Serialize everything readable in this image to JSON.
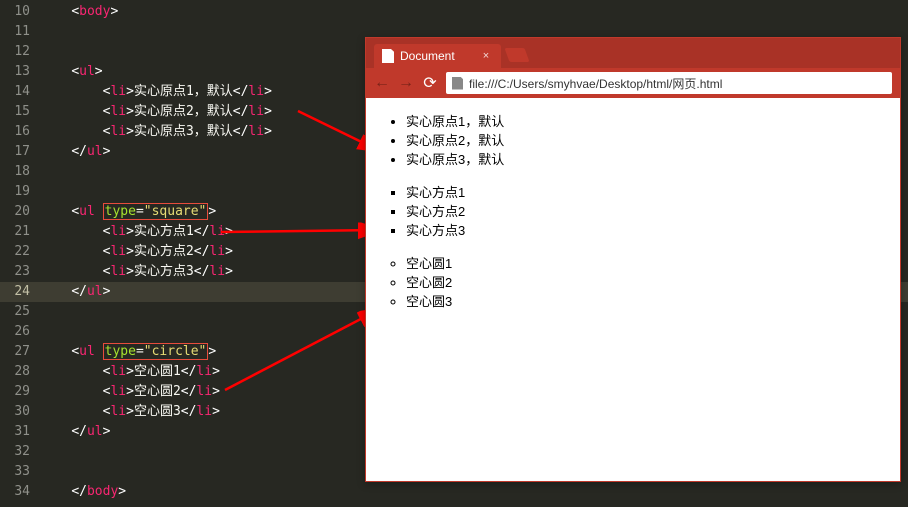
{
  "editor": {
    "lines": [
      {
        "n": 10,
        "html": "    <span class='br'>&lt;</span><span class='tag'>body</span><span class='br'>&gt;</span>"
      },
      {
        "n": 11,
        "html": ""
      },
      {
        "n": 12,
        "html": ""
      },
      {
        "n": 13,
        "html": "    <span class='br'>&lt;</span><span class='tag'>ul</span><span class='br'>&gt;</span>"
      },
      {
        "n": 14,
        "html": "        <span class='br'>&lt;</span><span class='tag'>li</span><span class='br'>&gt;</span>实心原点1，默认<span class='br'>&lt;/</span><span class='tag'>li</span><span class='br'>&gt;</span>"
      },
      {
        "n": 15,
        "html": "        <span class='br'>&lt;</span><span class='tag'>li</span><span class='br'>&gt;</span>实心原点2，默认<span class='br'>&lt;/</span><span class='tag'>li</span><span class='br'>&gt;</span>"
      },
      {
        "n": 16,
        "html": "        <span class='br'>&lt;</span><span class='tag'>li</span><span class='br'>&gt;</span>实心原点3，默认<span class='br'>&lt;/</span><span class='tag'>li</span><span class='br'>&gt;</span>"
      },
      {
        "n": 17,
        "html": "    <span class='br'>&lt;/</span><span class='tag'>ul</span><span class='br'>&gt;</span>"
      },
      {
        "n": 18,
        "html": ""
      },
      {
        "n": 19,
        "html": ""
      },
      {
        "n": 20,
        "html": "    <span class='br'>&lt;</span><span class='tag'>ul</span> <span class='boxed'><span class='attr'>type</span>=<span class='str'>&quot;square&quot;</span></span><span class='br'>&gt;</span>"
      },
      {
        "n": 21,
        "html": "        <span class='br'>&lt;</span><span class='tag'>li</span><span class='br'>&gt;</span>实心方点1<span class='br'>&lt;/</span><span class='tag'>li</span><span class='br'>&gt;</span>"
      },
      {
        "n": 22,
        "html": "        <span class='br'>&lt;</span><span class='tag'>li</span><span class='br'>&gt;</span>实心方点2<span class='br'>&lt;/</span><span class='tag'>li</span><span class='br'>&gt;</span>"
      },
      {
        "n": 23,
        "html": "        <span class='br'>&lt;</span><span class='tag'>li</span><span class='br'>&gt;</span>实心方点3<span class='br'>&lt;/</span><span class='tag'>li</span><span class='br'>&gt;</span>"
      },
      {
        "n": 24,
        "html": "    <span class='br'>&lt;/</span><span class='tag'>ul</span><span class='br'>&gt;</span>",
        "active": true
      },
      {
        "n": 25,
        "html": ""
      },
      {
        "n": 26,
        "html": ""
      },
      {
        "n": 27,
        "html": "    <span class='br'>&lt;</span><span class='tag'>ul</span> <span class='boxed'><span class='attr'>type</span>=<span class='str'>&quot;circle&quot;</span></span><span class='br'>&gt;</span>"
      },
      {
        "n": 28,
        "html": "        <span class='br'>&lt;</span><span class='tag'>li</span><span class='br'>&gt;</span>空心圆1<span class='br'>&lt;/</span><span class='tag'>li</span><span class='br'>&gt;</span>"
      },
      {
        "n": 29,
        "html": "        <span class='br'>&lt;</span><span class='tag'>li</span><span class='br'>&gt;</span>空心圆2<span class='br'>&lt;/</span><span class='tag'>li</span><span class='br'>&gt;</span>"
      },
      {
        "n": 30,
        "html": "        <span class='br'>&lt;</span><span class='tag'>li</span><span class='br'>&gt;</span>空心圆3<span class='br'>&lt;/</span><span class='tag'>li</span><span class='br'>&gt;</span>"
      },
      {
        "n": 31,
        "html": "    <span class='br'>&lt;/</span><span class='tag'>ul</span><span class='br'>&gt;</span>"
      },
      {
        "n": 32,
        "html": ""
      },
      {
        "n": 33,
        "html": ""
      },
      {
        "n": 34,
        "html": "    <span class='br'>&lt;/</span><span class='tag'>body</span><span class='br'>&gt;</span>"
      }
    ]
  },
  "browser": {
    "tab_title": "Document",
    "tab_close": "×",
    "url": "file:///C:/Users/smyhvae/Desktop/html/网页.html",
    "lists": [
      {
        "type": "disc",
        "items": [
          "实心原点1，默认",
          "实心原点2，默认",
          "实心原点3，默认"
        ]
      },
      {
        "type": "square",
        "items": [
          "实心方点1",
          "实心方点2",
          "实心方点3"
        ]
      },
      {
        "type": "circle",
        "items": [
          "空心圆1",
          "空心圆2",
          "空心圆3"
        ]
      }
    ]
  },
  "nav": {
    "back": "←",
    "forward": "→",
    "reload": "⟳"
  }
}
